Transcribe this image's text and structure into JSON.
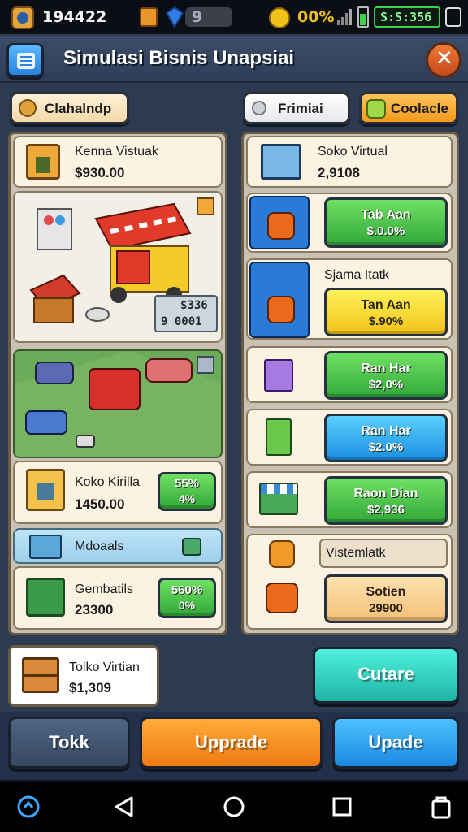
{
  "status_bar": {
    "coins": "194422",
    "gems": "9",
    "gold_percent": "00%",
    "timer": "S:S:356"
  },
  "title_bar": {
    "menu_icon": "hamburger-menu-icon",
    "title": "Simulasi Bisnis Unapsiai",
    "close_icon": "close-icon"
  },
  "tabs": {
    "left": "Clahalndp",
    "middle": "Frimiai",
    "right": "Coolacle"
  },
  "left_panel": {
    "header": {
      "name": "Kenna Vistuak",
      "price": "$930.00"
    },
    "store_badge": {
      "l1": "$336",
      "l2": "9 0001"
    },
    "koko": {
      "name": "Koko Kirilla",
      "price": "1450.00",
      "btn_l1": "55%",
      "btn_l2": "4%"
    },
    "modules": {
      "title": "Mdoaals"
    },
    "gembatils": {
      "name": "Gembatils",
      "price": "23300",
      "btn_l1": "560%",
      "btn_l2": "0%"
    }
  },
  "right_panel": {
    "header": {
      "name": "Soko Virtual",
      "price": "2,9108"
    },
    "items": [
      {
        "label": "",
        "btn_l1": "Tab Aan",
        "btn_l2": "$.0.0%",
        "color": "green"
      },
      {
        "label": "Sjama Itatk",
        "btn_l1": "Tan Aan",
        "btn_l2": "$.90%",
        "color": "yellow"
      },
      {
        "label": "",
        "btn_l1": "Ran Har",
        "btn_l2": "$2,0%",
        "color": "green"
      },
      {
        "label": "",
        "btn_l1": "Ran Har",
        "btn_l2": "$2.0%",
        "color": "blue"
      },
      {
        "label": "",
        "btn_l1": "Raon Dian",
        "btn_l2": "$2,936",
        "color": "green"
      },
      {
        "label": "Vistemlatk",
        "btn_l1": "Sotien",
        "btn_l2": "29900",
        "color": "peach"
      }
    ]
  },
  "summary_card": {
    "name": "Tolko Virtian",
    "price": "$1,309"
  },
  "buttons": {
    "cutare": "Cutare",
    "tokk": "Tokk",
    "upgrade": "Upprade",
    "upade": "Upade"
  },
  "colors": {
    "accent_green": "#32a83a",
    "accent_orange": "#f5891c",
    "accent_blue": "#1b8fe0",
    "teal": "#23c8b5"
  }
}
